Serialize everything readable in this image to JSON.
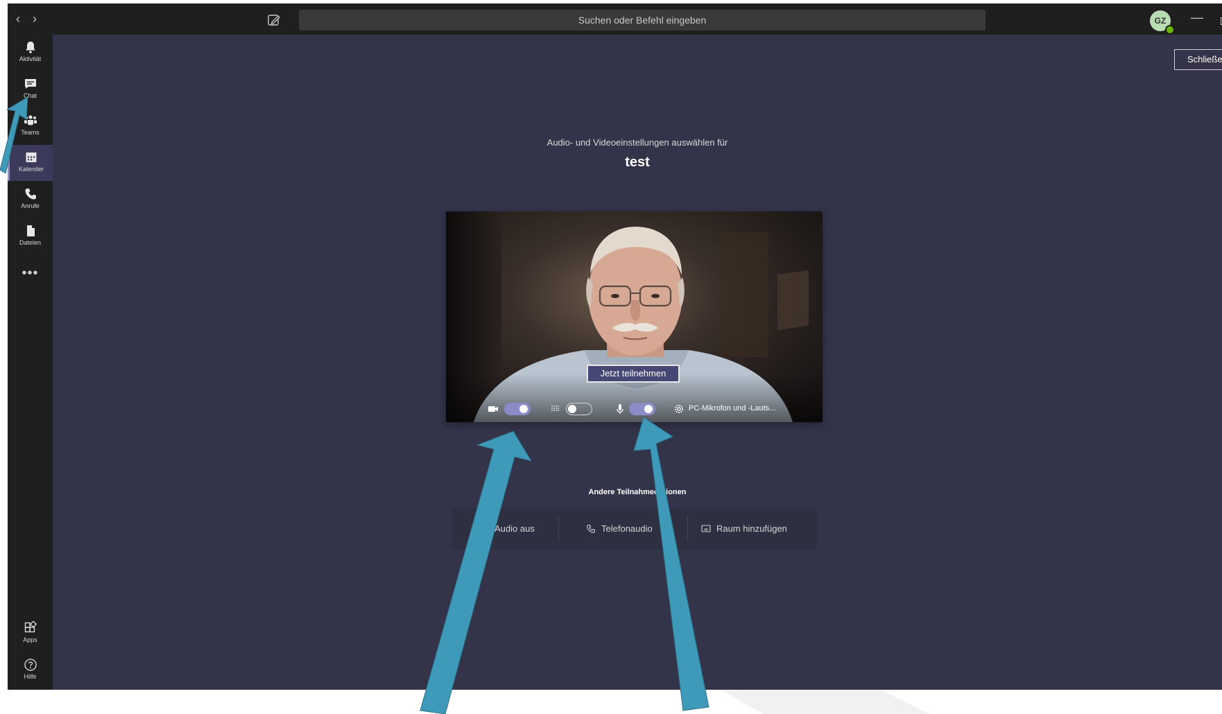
{
  "topbar": {
    "back_icon": "‹",
    "forward_icon": "›",
    "search_placeholder": "Suchen oder Befehl eingeben",
    "avatar_initials": "GZ",
    "minimize_icon": "—"
  },
  "rail": {
    "items": [
      {
        "label": "Aktivität",
        "icon": "bell-icon"
      },
      {
        "label": "Chat",
        "icon": "chat-icon"
      },
      {
        "label": "Teams",
        "icon": "teams-icon"
      },
      {
        "label": "Kalender",
        "icon": "calendar-icon"
      },
      {
        "label": "Anrufe",
        "icon": "phone-icon"
      },
      {
        "label": "Dateien",
        "icon": "file-icon"
      }
    ],
    "more": "•••",
    "bottom_items": [
      {
        "label": "Apps",
        "icon": "apps-icon"
      },
      {
        "label": "Hilfe",
        "icon": "help-icon"
      }
    ]
  },
  "main": {
    "close_label": "Schließen",
    "subtitle": "Audio- und Videoeinstellungen auswählen für",
    "meeting_title": "test",
    "join_label": "Jetzt teilnehmen",
    "controls": {
      "camera_on": true,
      "blur_on": false,
      "mic_on": true,
      "device_label": "PC-Mikrofon und -Lauts..."
    },
    "other_label": "Andere Teilnahmeoptionen",
    "options": [
      {
        "label": "Audio aus",
        "icon": "speaker-off-icon"
      },
      {
        "label": "Telefonaudio",
        "icon": "phone-icon"
      },
      {
        "label": "Raum hinzufügen",
        "icon": "cast-icon"
      }
    ]
  },
  "colors": {
    "rail_bg": "#1f1f1f",
    "main_bg": "#33344a",
    "accent": "#8b8cc7",
    "join_button": "#464775",
    "annotation_arrow": "#3f9ab9"
  }
}
